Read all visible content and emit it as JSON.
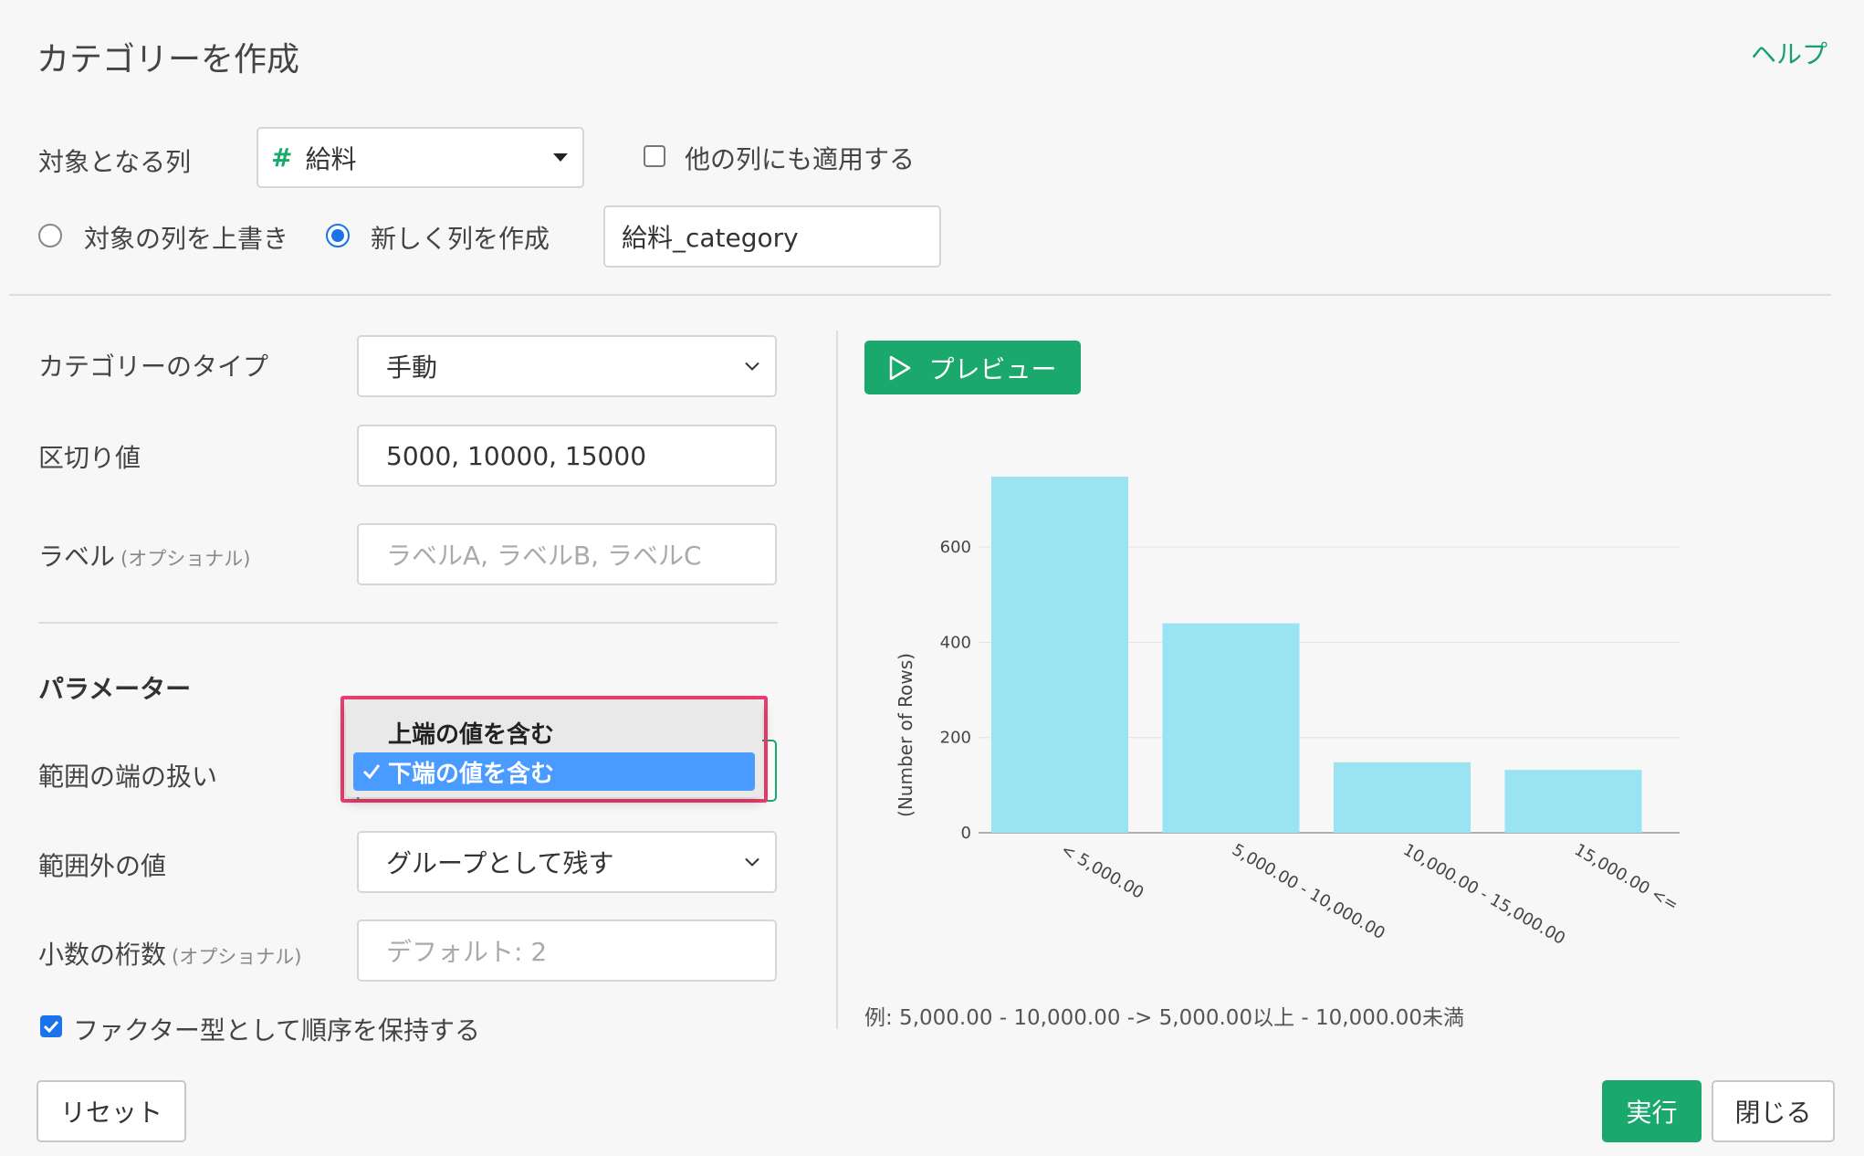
{
  "header": {
    "title": "カテゴリーを作成",
    "help_label": "ヘルプ"
  },
  "target": {
    "label": "対象となる列",
    "column_icon": "#",
    "column_value": "給料",
    "apply_others_label": "他の列にも適用する",
    "apply_others_checked": false
  },
  "output": {
    "overwrite_label": "対象の列を上書き",
    "create_new_label": "新しく列を作成",
    "selected": "create_new",
    "new_column_name": "給料_category"
  },
  "form": {
    "category_type_label": "カテゴリーのタイプ",
    "category_type_value": "手動",
    "breaks_label": "区切り値",
    "breaks_value": "5000, 10000, 15000",
    "labels_label": "ラベル",
    "optional_tag": "(オプショナル)",
    "labels_placeholder": "ラベルA, ラベルB, ラベルC"
  },
  "parameters": {
    "heading": "パラメーター",
    "range_edge_label": "範囲の端の扱い",
    "range_edge_options": [
      "上端の値を含む",
      "下端の値を含む"
    ],
    "range_edge_selected": "下端の値を含む",
    "out_of_range_label": "範囲外の値",
    "out_of_range_value": "グループとして残す",
    "decimals_label": "小数の桁数",
    "decimals_placeholder": "デフォルト: 2",
    "factor_label": "ファクター型として順序を保持する",
    "factor_checked": true
  },
  "preview": {
    "button_label": "プレビュー"
  },
  "chart_data": {
    "type": "bar",
    "categories": [
      "< 5,000.00",
      "5,000.00 - 10,000.00",
      "10,000.00 - 15,000.00",
      "15,000.00 <="
    ],
    "values": [
      748,
      440,
      148,
      132
    ],
    "title": "",
    "xlabel": "",
    "ylabel": "(Number of Rows)",
    "ylim": [
      0,
      748
    ],
    "yticks": [
      0,
      200,
      400,
      600
    ],
    "grid": true,
    "bar_color": "#9ae3f3"
  },
  "example_text": "例: 5,000.00 - 10,000.00 -> 5,000.00以上 - 10,000.00未満",
  "footer": {
    "reset_label": "リセット",
    "run_label": "実行",
    "close_label": "閉じる"
  },
  "colors": {
    "accent_green": "#1aa86c",
    "selection_blue": "#4a9bff",
    "highlight_pink": "#ee3e72"
  }
}
